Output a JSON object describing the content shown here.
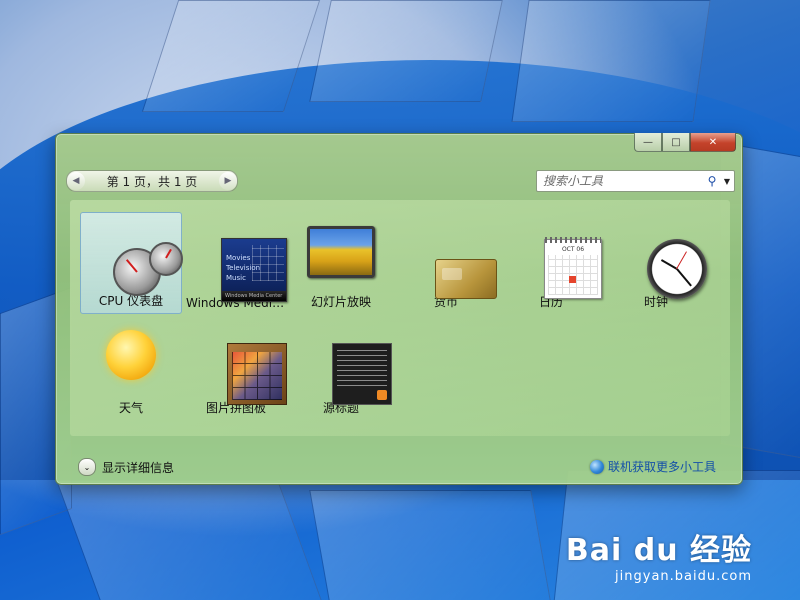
{
  "window": {
    "controls": {
      "minimize": "—",
      "maximize": "□",
      "close": "✕"
    },
    "pager": {
      "prev_icon": "◀",
      "label": "第 1 页，共 1 页",
      "next_icon": "▶"
    },
    "search": {
      "placeholder": "搜索小工具",
      "search_icon": "⚲",
      "dropdown_icon": "▼"
    }
  },
  "gadgets": [
    {
      "label": "CPU 仪表盘",
      "icon": "cpu-meter-icon",
      "selected": true
    },
    {
      "label": "Windows Media Center",
      "icon": "media-center-icon",
      "selected": false,
      "thumb_lines": [
        "Movies",
        "Television",
        "Music"
      ],
      "thumb_bar": "Windows Media Center"
    },
    {
      "label": "幻灯片放映",
      "icon": "slideshow-icon",
      "selected": false
    },
    {
      "label": "货币",
      "icon": "currency-icon",
      "selected": false
    },
    {
      "label": "日历",
      "icon": "calendar-icon",
      "selected": false,
      "thumb_month": "OCT 06"
    },
    {
      "label": "时钟",
      "icon": "clock-icon",
      "selected": false
    },
    {
      "label": "天气",
      "icon": "weather-icon",
      "selected": false
    },
    {
      "label": "图片拼图板",
      "icon": "picture-puzzle-icon",
      "selected": false
    },
    {
      "label": "源标题",
      "icon": "feed-headlines-icon",
      "selected": false
    }
  ],
  "footer": {
    "details_icon": "⌄",
    "details_label": "显示详细信息",
    "get_more_label": "联机获取更多小工具"
  },
  "watermark": {
    "brand": "Bai du 经验",
    "url": "jingyan.baidu.com"
  }
}
